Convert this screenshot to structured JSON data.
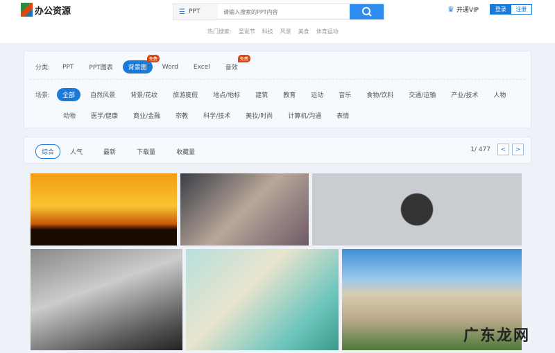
{
  "header": {
    "logo_text": "办公资源",
    "search_type": "PPT",
    "search_placeholder": "请输入搜索的PPT内容",
    "hot_label": "热门搜索:",
    "hot_terms": [
      "圣诞节",
      "科技",
      "风景",
      "美食",
      "体育运动"
    ],
    "vip_label": "开通VIP",
    "login": "登录",
    "register": "注册"
  },
  "category": {
    "label": "分类:",
    "items": [
      "PPT",
      "PPT图表",
      "背景图",
      "Word",
      "Excel",
      "音效"
    ],
    "badge": "免费"
  },
  "scene": {
    "label": "场景:",
    "items": [
      "全部",
      "自然风景",
      "背景/花纹",
      "旅游度假",
      "地点/地标",
      "建筑",
      "教育",
      "运动",
      "音乐",
      "食物/饮料",
      "交通/运输",
      "产业/技术",
      "人物",
      "动物",
      "医学/健康",
      "商业/金融",
      "宗教",
      "科学/技术",
      "美妆/时尚",
      "计算机/沟通",
      "表情"
    ]
  },
  "sort": {
    "items": [
      "综合",
      "人气",
      "最新",
      "下载量",
      "收藏量"
    ],
    "page": "1/ 477",
    "prev": "<",
    "next": ">"
  },
  "watermark": "广东龙网"
}
